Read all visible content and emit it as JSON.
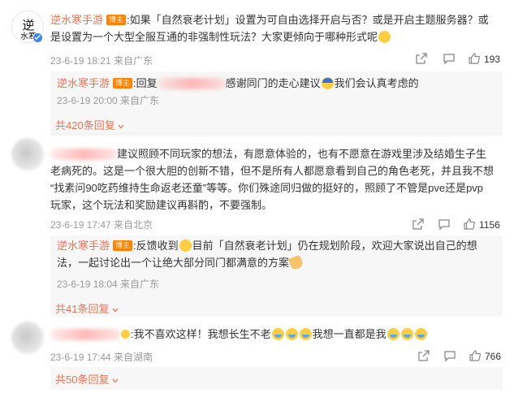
{
  "colors": {
    "accent": "#eb7350",
    "badge": "#ff8200",
    "meta": "#999999",
    "reply_bg": "#f7f7f7"
  },
  "comments": [
    {
      "username": "逆水寒手游",
      "tag": "博主",
      "line1": ":如果「自然衰老计划」设置为可自由选择开启与否？或是开启主题服务器？或",
      "line2": "是设置为一个大型全服互通的非强制性玩法？大家更倾向于哪种形式呢",
      "time": "23-6-19 18:21 来自广东",
      "likes": "193",
      "reply": {
        "username": "逆水寒手游",
        "tag": "博主",
        "prefix": ":回复",
        "text": "感谢同门的走心建议",
        "text2": "我们会认真考虑的",
        "time": "23-6-19 20:00 来自广东"
      },
      "more": "共420条回复"
    },
    {
      "line1": "建议照顾不同玩家的想法，有愿意体验的，也有不愿意在游戏里涉及结婚生子生",
      "line2": "老病死的。这是一个很大胆的创新不错，但不是所有人都愿意看到自己的角色老死，并且我不想",
      "line3": "“找素问90吃药维持生命返老还童”等等。你们殊途同归做的挺好的，照顾了不管是pve还是pvp",
      "line4": "玩家，这个玩法和奖励建议再斟酌，不要强制。",
      "time": "23-6-19 17:47 来自北京",
      "likes": "1156",
      "reply": {
        "username": "逆水寒手游",
        "tag": "博主",
        "prefix": ":反馈收到",
        "text": "目前「自然衰老计划」仍在规划阶段，欢迎大家说出自己的想",
        "text2": "法，一起讨论出一个让绝大部分同门都满意的方案",
        "time": "23-6-19 18:04 来自广东"
      },
      "more": "共41条回复"
    },
    {
      "text": ":我不喜欢这样！我想长生不老",
      "text2": "我想一直都是我",
      "time": "23-6-19 17:44 来自湖南",
      "likes": "766",
      "more": "共50条回复"
    }
  ]
}
